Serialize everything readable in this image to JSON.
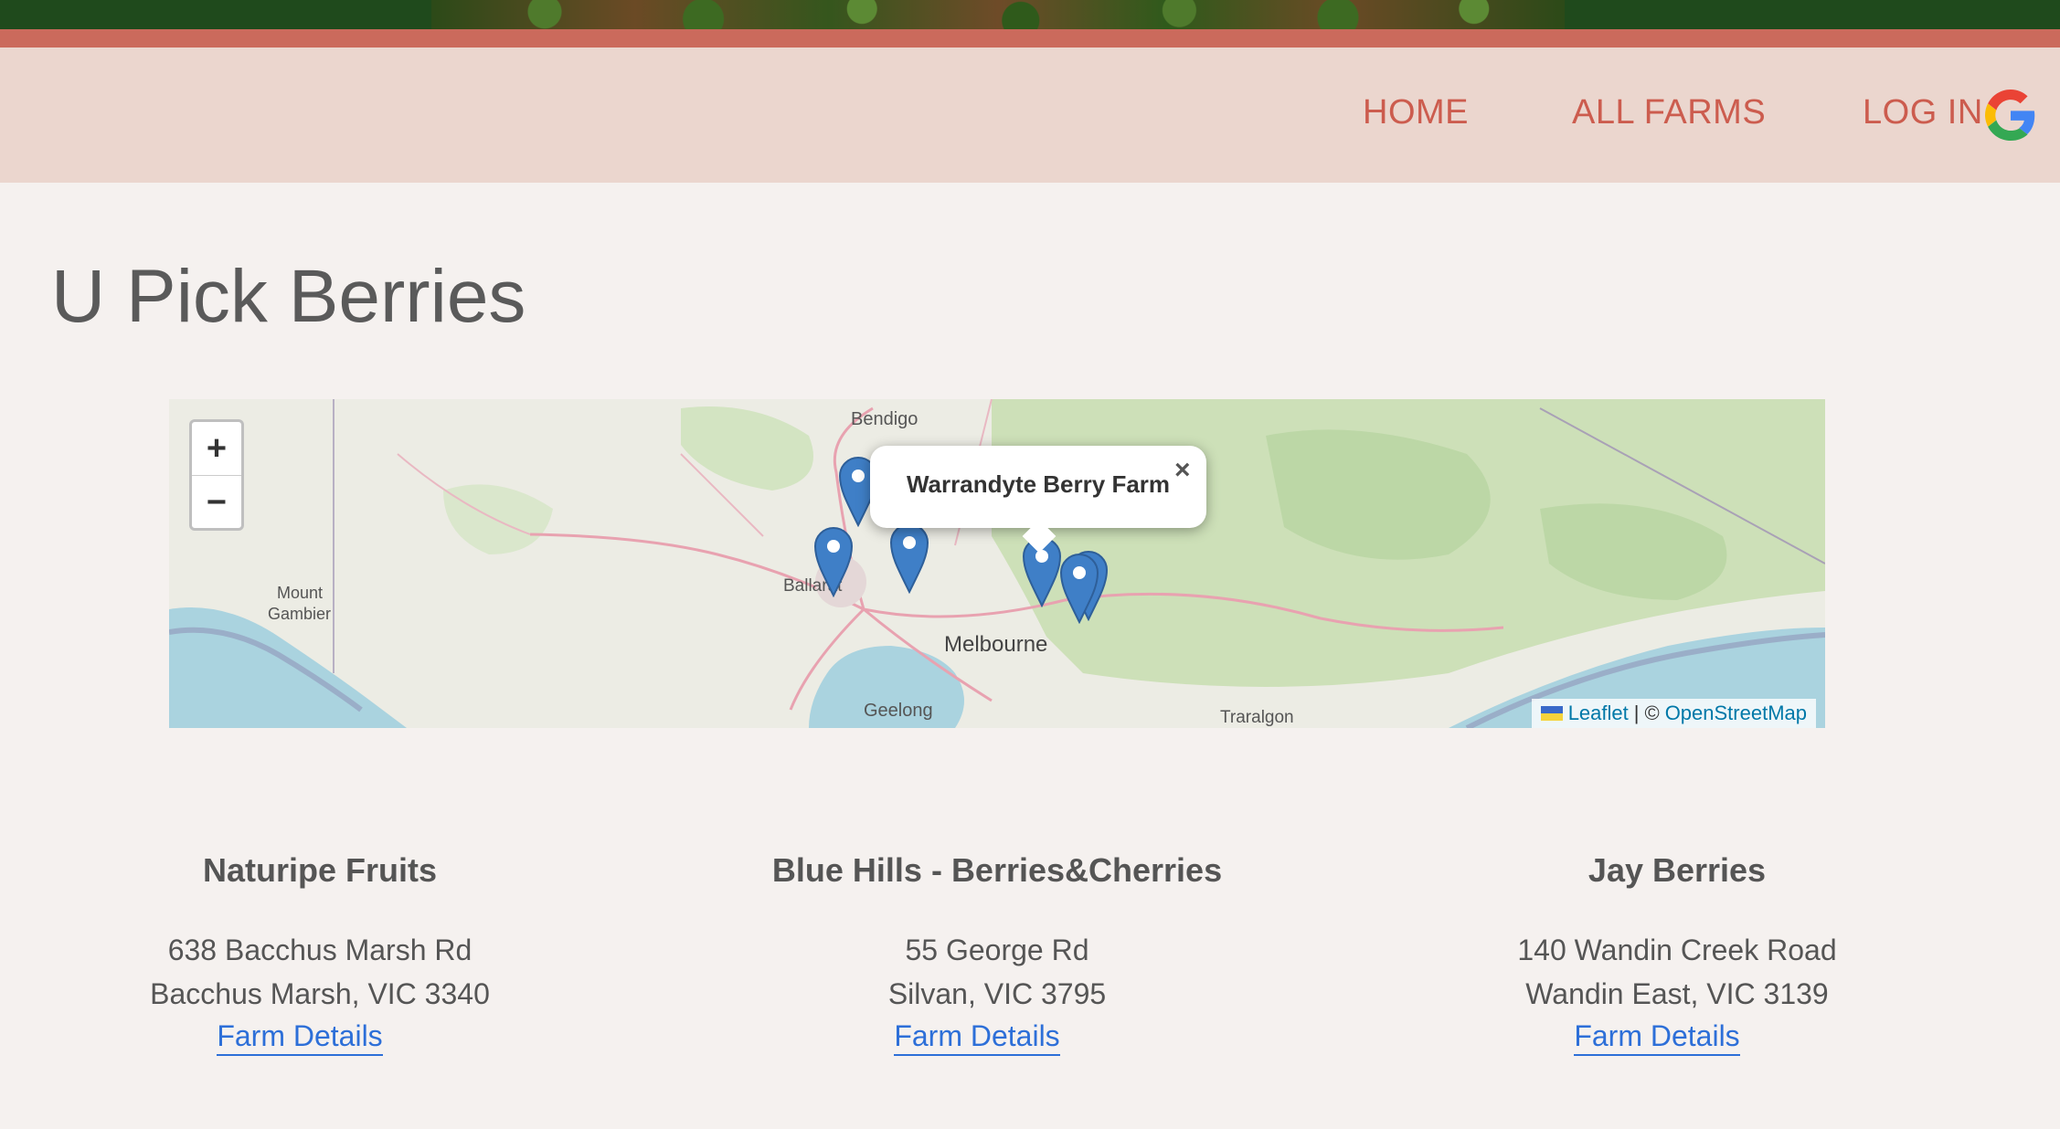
{
  "nav": {
    "home": "HOME",
    "all_farms": "ALL FARMS",
    "log_in": "LOG IN",
    "login_icon": "google-icon"
  },
  "page": {
    "title": "U Pick Berries"
  },
  "map": {
    "zoom_in": "+",
    "zoom_out": "−",
    "popup": {
      "title": "Warrandyte Berry Farm",
      "close": "×"
    },
    "labels": {
      "bendigo": "Bendigo",
      "ballarat": "Ballarat",
      "melbourne": "Melbourne",
      "geelong": "Geelong",
      "traralgon": "Traralgon",
      "mount": "Mount",
      "gambier": "Gambier"
    },
    "attribution": {
      "leaflet": "Leaflet",
      "separator": "|",
      "copyright": "©",
      "osm": "OpenStreetMap"
    },
    "marker_icon": "map-pin-icon",
    "marker_color": "#3f7fc7"
  },
  "farms": [
    {
      "name": "Naturipe Fruits",
      "address1": "638 Bacchus Marsh Rd",
      "address2": "Bacchus Marsh, VIC 3340",
      "link": "Farm Details"
    },
    {
      "name": "Blue Hills - Berries&Cherries",
      "address1": "55 George Rd",
      "address2": "Silvan, VIC 3795",
      "link": "Farm Details"
    },
    {
      "name": "Jay Berries",
      "address1": "140 Wandin Creek Road",
      "address2": "Wandin East, VIC 3139",
      "link": "Farm Details"
    }
  ],
  "colors": {
    "nav_text": "#cc5c4e",
    "nav_bg": "#ebd6ce",
    "accent_line": "#cb6a5c",
    "link": "#2d6fd8"
  }
}
